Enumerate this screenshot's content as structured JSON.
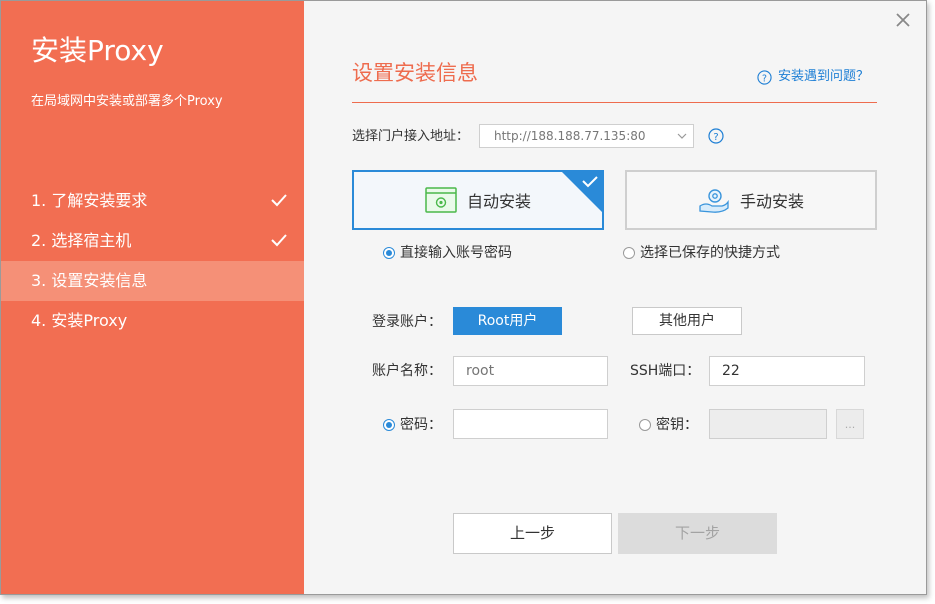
{
  "sidebar": {
    "app_title": "安装Proxy",
    "subtitle": "在局域网中安装或部署多个Proxy",
    "steps": [
      {
        "label": "1. 了解安装要求",
        "done": true
      },
      {
        "label": "2. 选择宿主机",
        "done": true
      },
      {
        "label": "3. 设置安装信息",
        "active": true
      },
      {
        "label": "4. 安装Proxy"
      }
    ]
  },
  "main": {
    "title": "设置安装信息",
    "help_link": "安装遇到问题？",
    "portal": {
      "label": "选择门户接入地址：",
      "selected": "http://188.188.77.135:80"
    },
    "install_modes": {
      "auto": "自动安装",
      "manual": "手动安装",
      "selected": "auto"
    },
    "credential_options": {
      "direct": "直接输入账号密码",
      "saved": "选择已保存的快捷方式",
      "selected": "direct"
    },
    "login_account": {
      "label": "登录账户：",
      "root_button": "Root用户",
      "other_button": "其他用户",
      "selected": "root"
    },
    "account_name": {
      "label": "账户名称：",
      "placeholder": "root",
      "value": ""
    },
    "ssh_port": {
      "label": "SSH端口：",
      "value": "22"
    },
    "auth": {
      "password_label": "密码：",
      "key_label": "密钥：",
      "browse": "...",
      "selected": "password"
    },
    "buttons": {
      "prev": "上一步",
      "next": "下一步"
    }
  },
  "colors": {
    "sidebar": "#f26e52",
    "sidebar_active": "#f59077",
    "accent_blue": "#2a8ad8",
    "title_orange": "#ee6c4e"
  }
}
